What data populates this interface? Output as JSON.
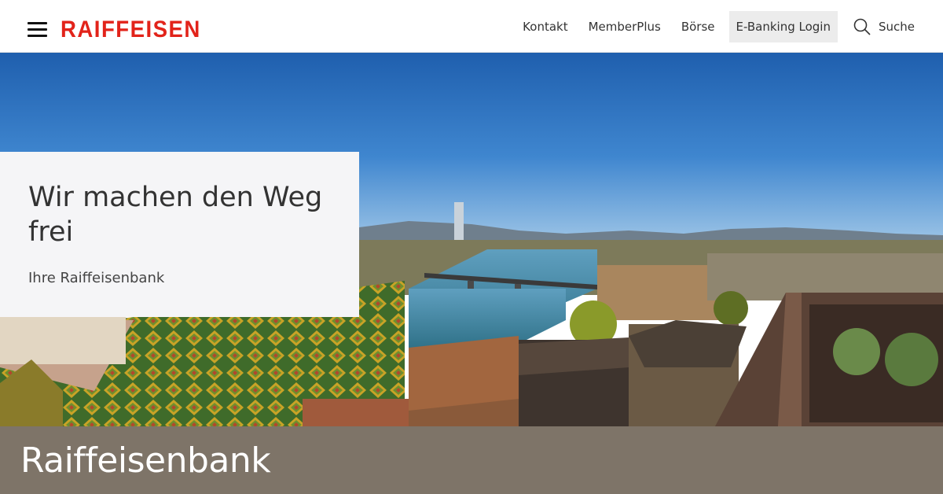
{
  "header": {
    "logo": "RAIFFEISEN",
    "nav": [
      "Kontakt",
      "MemberPlus",
      "Börse",
      "E-Banking Login"
    ],
    "search_label": "Suche"
  },
  "hero": {
    "title": "Wir machen den Weg frei",
    "subtitle": "Ihre Raiffeisenbank"
  },
  "band": {
    "title": "Raiffeisenbank"
  },
  "colors": {
    "brand_red": "#e2231a",
    "band": "#7e7468",
    "card": "#f5f5f7"
  }
}
